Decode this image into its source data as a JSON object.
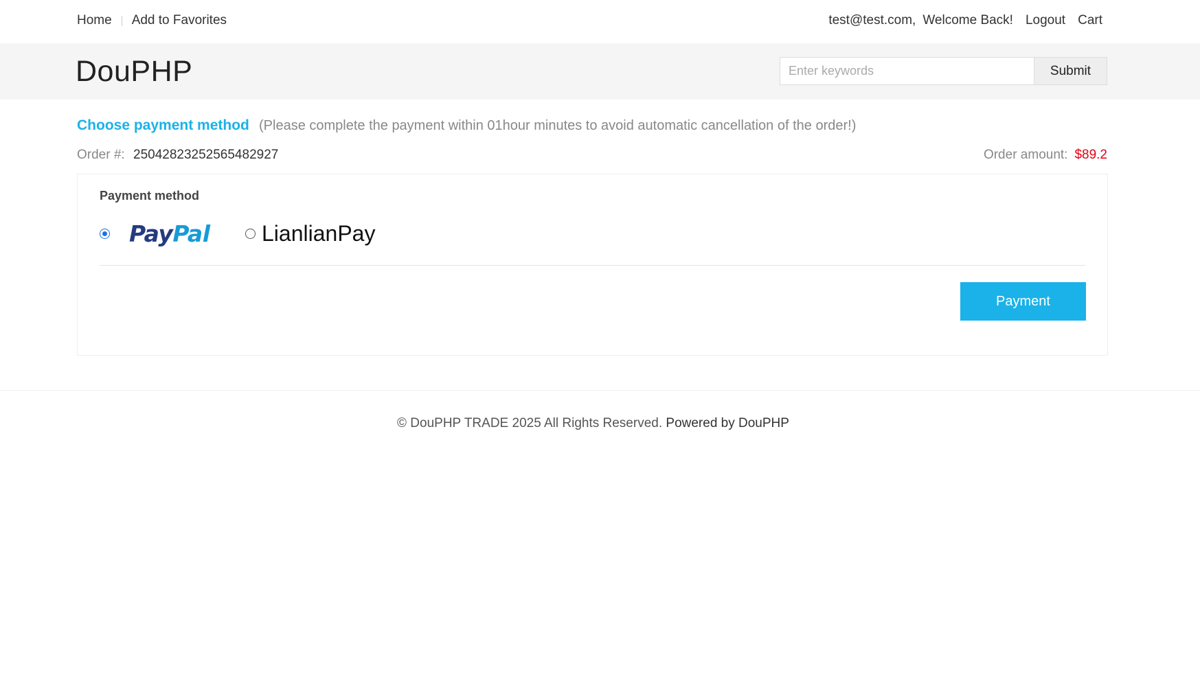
{
  "topbar": {
    "home": "Home",
    "add_to_favorites": "Add to Favorites",
    "user_email": "test@test.com,",
    "welcome": "Welcome Back!",
    "logout": "Logout",
    "cart": "Cart"
  },
  "header": {
    "logo": "DouPHP",
    "search_placeholder": "Enter keywords",
    "search_button": "Submit"
  },
  "payment_page": {
    "title": "Choose payment method",
    "note": "(Please complete the payment within 01hour minutes to avoid automatic cancellation of the order!)",
    "order_no_label": "Order #:",
    "order_no": "25042823252565482927",
    "order_amount_label": "Order amount:",
    "order_amount": "$89.2",
    "method_label": "Payment method",
    "methods": [
      {
        "pay_part": "Pay",
        "pal_part": "Pal",
        "selected": true
      },
      {
        "label": "LianlianPay",
        "selected": false
      }
    ],
    "pay_button": "Payment"
  },
  "footer": {
    "copyright": "© DouPHP TRADE 2025 All Rights Reserved.",
    "powered_by": "Powered by DouPHP"
  },
  "colors": {
    "accent": "#1ab2e8",
    "price": "#e60012",
    "paypal_dark": "#253b80",
    "paypal_light": "#179bd7"
  }
}
